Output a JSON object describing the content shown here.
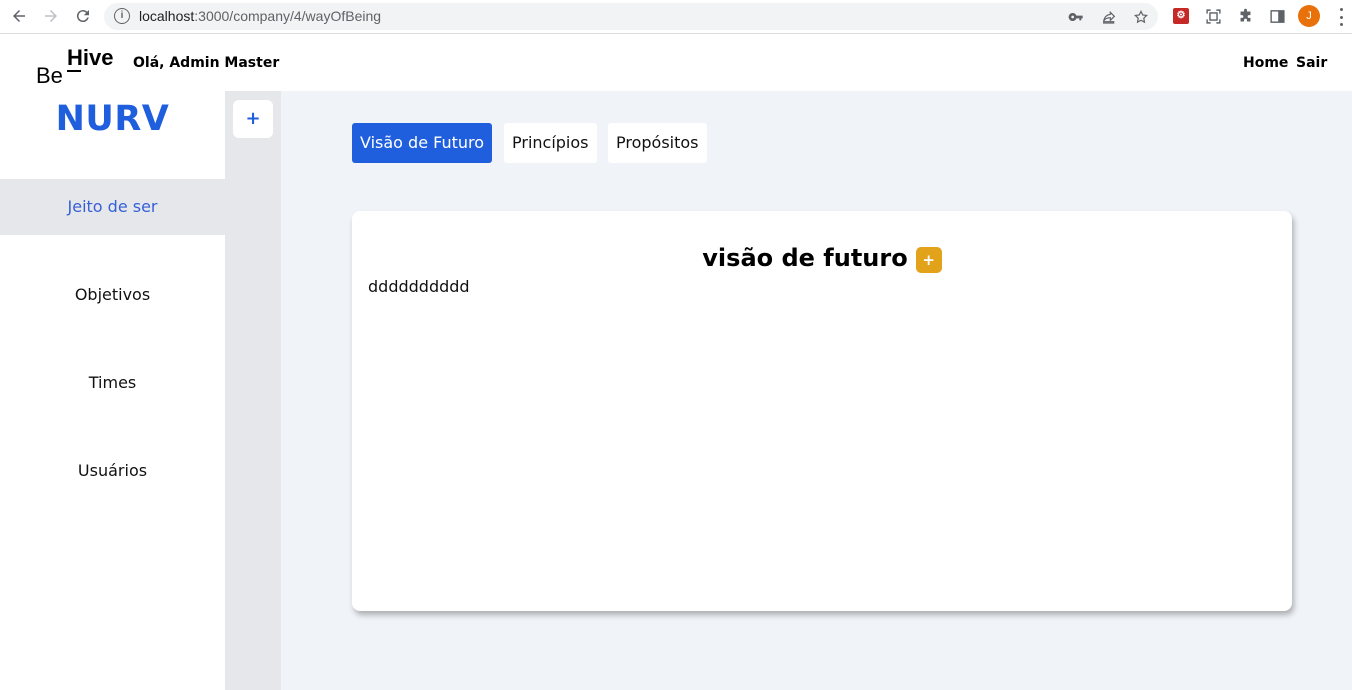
{
  "browser": {
    "url_host": "localhost",
    "url_path": ":3000/company/4/wayOfBeing",
    "profile_initial": "J",
    "icons": [
      "back-arrow-icon",
      "forward-arrow-icon",
      "reload-icon",
      "site-info-icon",
      "key-icon",
      "share-icon",
      "star-icon",
      "extension-icon",
      "screenshot-icon",
      "puzzle-icon",
      "side-panel-icon",
      "kebab-menu-icon"
    ]
  },
  "header": {
    "logo_be": "Be",
    "logo_hive": "Hive",
    "greeting": "Olá, Admin Master",
    "home_label": "Home",
    "logout_label": "Sair"
  },
  "sidebar": {
    "company": "NURV",
    "items": [
      {
        "label": "Jeito de ser",
        "active": true
      },
      {
        "label": "Objetivos",
        "active": false
      },
      {
        "label": "Times",
        "active": false
      },
      {
        "label": "Usuários",
        "active": false
      }
    ],
    "rail_add_label": "+"
  },
  "main": {
    "tabs": [
      {
        "label": "Visão de Futuro",
        "active": true
      },
      {
        "label": "Princípios",
        "active": false
      },
      {
        "label": "Propósitos",
        "active": false
      }
    ],
    "card": {
      "title": "visão de futuro",
      "add_label": "+",
      "content": "dddddddddd"
    }
  },
  "colors": {
    "primary": "#1f5fde",
    "accent": "#e2a21a",
    "sidebar_active_bg": "#e5e7eb",
    "main_bg": "#f0f3f8"
  }
}
